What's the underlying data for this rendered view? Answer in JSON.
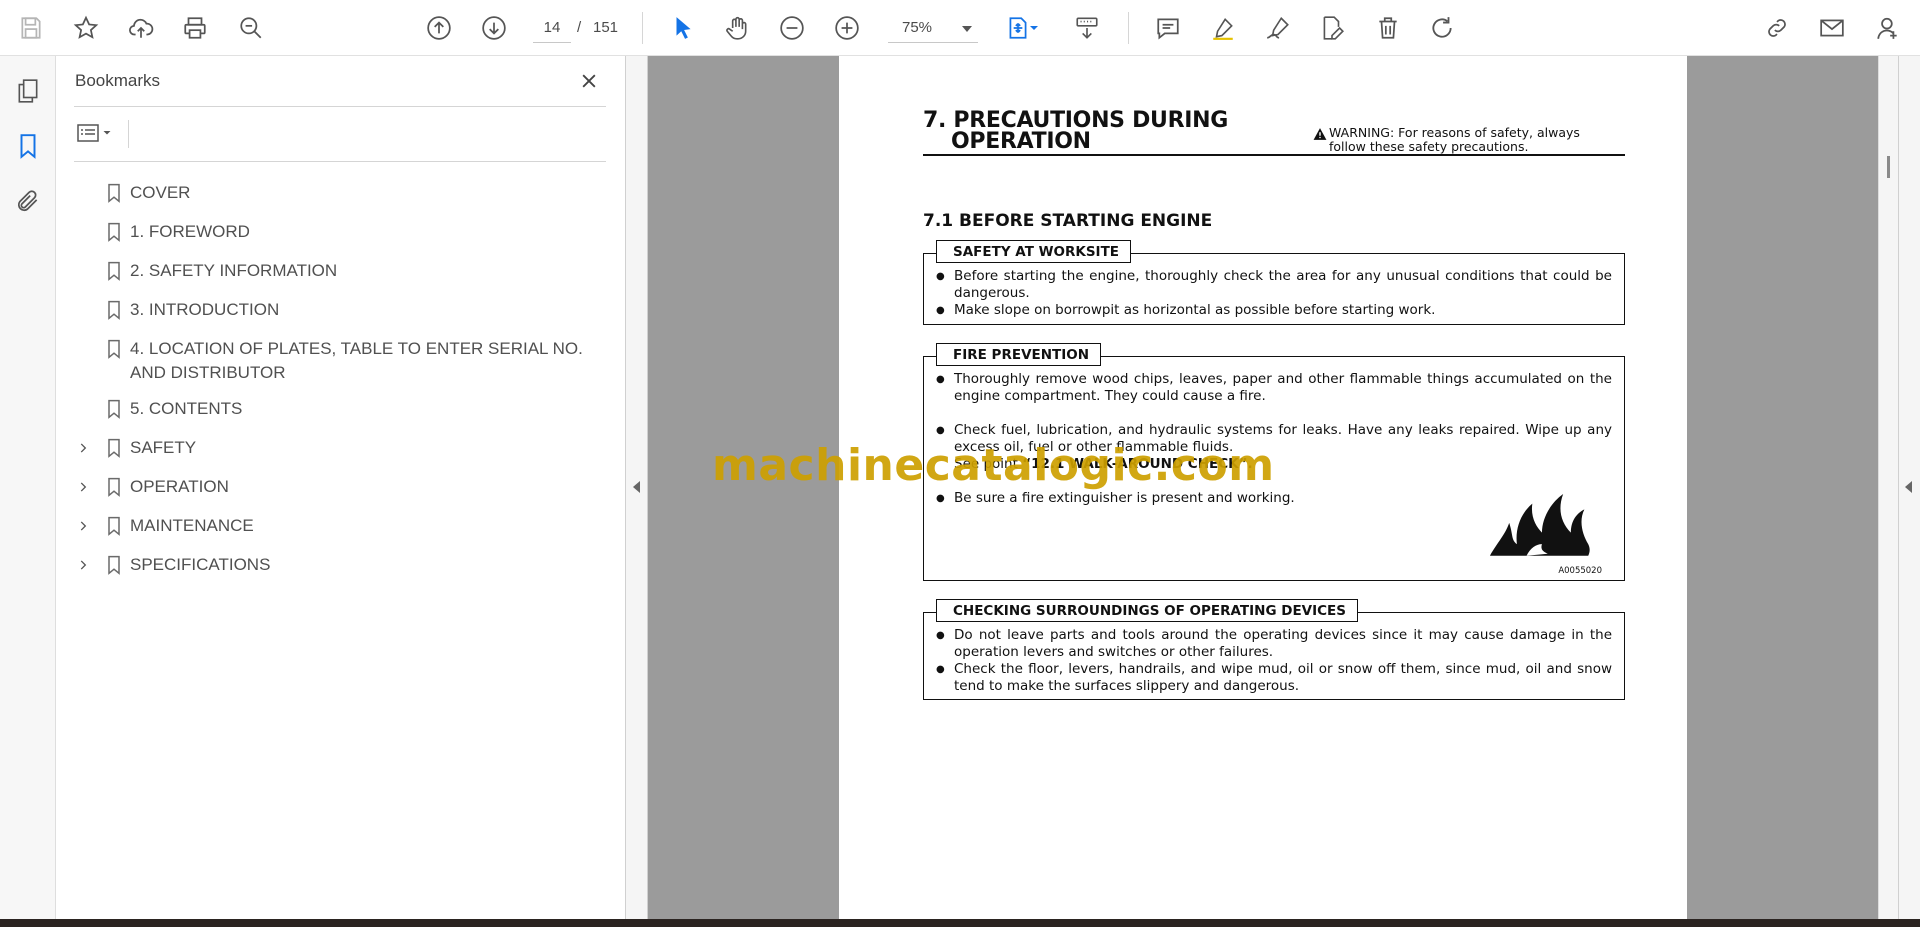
{
  "toolbar": {
    "page_current": "14",
    "page_separator": "/",
    "page_total": "151",
    "zoom": "75%"
  },
  "bookmarks_panel": {
    "title": "Bookmarks",
    "items": [
      {
        "label": "COVER",
        "expandable": false
      },
      {
        "label": "1. FOREWORD",
        "expandable": false
      },
      {
        "label": "2. SAFETY INFORMATION",
        "expandable": false
      },
      {
        "label": "3. INTRODUCTION",
        "expandable": false
      },
      {
        "label": "4. LOCATION OF PLATES, TABLE TO ENTER SERIAL NO. AND DISTRIBUTOR",
        "expandable": false
      },
      {
        "label": "5. CONTENTS",
        "expandable": false
      },
      {
        "label": "SAFETY",
        "expandable": true
      },
      {
        "label": "OPERATION",
        "expandable": true
      },
      {
        "label": "MAINTENANCE",
        "expandable": true
      },
      {
        "label": "SPECIFICATIONS",
        "expandable": true
      }
    ]
  },
  "document": {
    "heading_line1": "7. PRECAUTIONS DURING",
    "heading_line2": "OPERATION",
    "warning_line1": "WARNING: For reasons of safety, always",
    "warning_line2": "follow these safety precautions.",
    "section_title": "7.1  BEFORE STARTING ENGINE",
    "boxes": [
      {
        "title": "SAFETY AT WORKSITE",
        "bullets": [
          "Before starting the engine, thoroughly check the area for any unusual conditions that could be dangerous.",
          "Make slope on borrowpit as horizontal as possible before starting work."
        ]
      },
      {
        "title": "FIRE PREVENTION",
        "bullet1": "Thoroughly remove wood chips, leaves, paper and other flammable things accumulated on the engine compartment. They could cause a fire.",
        "bullet2": "Check fuel, lubrication, and hydraulic systems for leaks. Have any leaks repaired. Wipe up any excess oil, fuel or other flammable fluids.",
        "bullet2_ref_prefix": "See point",
        "bullet2_ref": "“12.1 WALK-AROUND CHECK”.",
        "bullet3": "Be sure a fire extinguisher is present and working.",
        "figure_code": "A0055020"
      },
      {
        "title": "CHECKING SURROUNDINGS OF OPERATING DEVICES",
        "bullets": [
          "Do not leave parts and tools around the operating devices since it may cause damage in the operation levers and switches or other failures.",
          "Check the floor, levers, handrails, and wipe mud, oil or snow off them, since mud, oil and snow tend to make the surfaces slippery and dangerous."
        ]
      }
    ]
  },
  "watermark": "machinecatalogic.com",
  "colors": {
    "accent_blue": "#1473e6",
    "viewer_gray": "#9b9b9b",
    "watermark_gold": "#cda000"
  }
}
